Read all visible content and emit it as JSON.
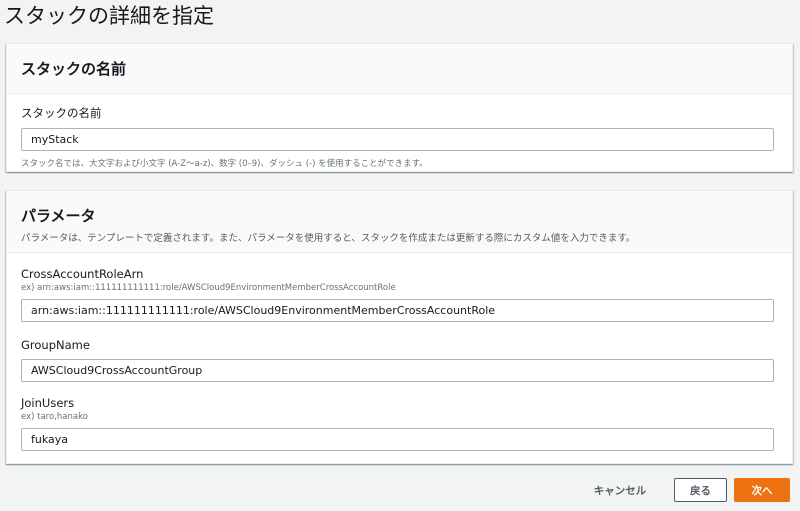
{
  "page": {
    "title": "スタックの詳細を指定"
  },
  "stack_name_section": {
    "title": "スタックの名前",
    "field": {
      "label": "スタックの名前",
      "value": "myStack",
      "hint": "スタック名では、大文字および小文字 (A-Z〜a-z)、数字 (0–9)、ダッシュ (-) を使用することができます。"
    }
  },
  "parameters_section": {
    "title": "パラメータ",
    "description": "パラメータは、テンプレートで定義されます。また、パラメータを使用すると、スタックを作成または更新する際にカスタム値を入力できます。",
    "fields": [
      {
        "label": "CrossAccountRoleArn",
        "sub": "ex) arn:aws:iam::111111111111:role/AWSCloud9EnvironmentMemberCrossAccountRole",
        "value": "arn:aws:iam::111111111111:role/AWSCloud9EnvironmentMemberCrossAccountRole"
      },
      {
        "label": "GroupName",
        "sub": "",
        "value": "AWSCloud9CrossAccountGroup"
      },
      {
        "label": "JoinUsers",
        "sub": "ex) taro,hanako",
        "value": "fukaya"
      }
    ]
  },
  "footer": {
    "cancel_label": "キャンセル",
    "back_label": "戻る",
    "next_label": "次へ"
  },
  "colors": {
    "primary_button": "#ec7211",
    "page_background": "#f2f3f3"
  }
}
